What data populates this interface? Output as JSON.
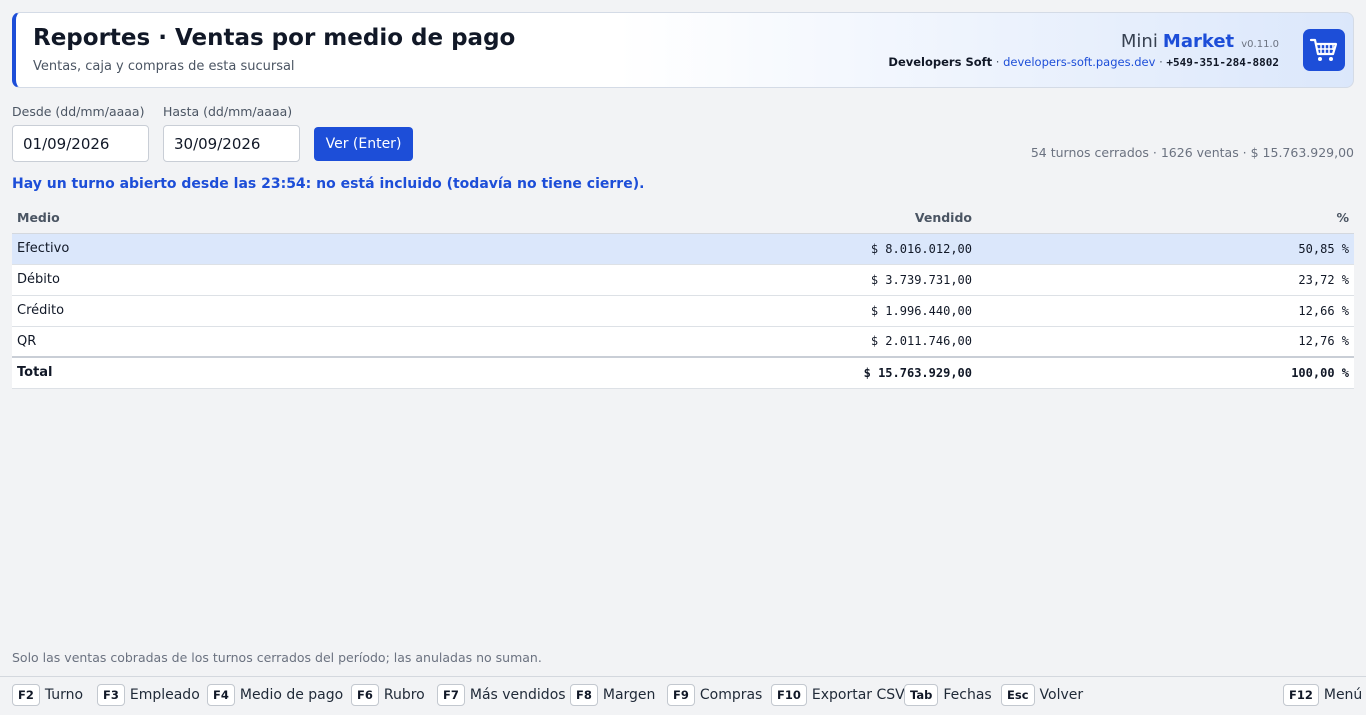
{
  "header": {
    "title": "Reportes · Ventas por medio de pago",
    "subtitle": "Ventas, caja y compras de esta sucursal",
    "brand_mini": "Mini",
    "brand_market": "Market",
    "version": "v0.11.0",
    "company": "Developers Soft",
    "sep1": " · ",
    "url": "developers-soft.pages.dev",
    "sep2": " · ",
    "phone": "+549-351-284-8802",
    "icon": "shopping-cart-icon"
  },
  "filters": {
    "desde_label": "Desde (dd/mm/aaaa)",
    "desde_value": "01/09/2026",
    "hasta_label": "Hasta (dd/mm/aaaa)",
    "hasta_value": "30/09/2026",
    "button_label": "Ver (Enter)"
  },
  "summary": "54 turnos cerrados · 1626 ventas · $ 15.763.929,00",
  "notice": "Hay un turno abierto desde las 23:54: no está incluido (todavía no tiene cierre).",
  "table": {
    "columns": [
      "Medio",
      "Vendido",
      "%"
    ],
    "rows": [
      {
        "medio": "Efectivo",
        "vendido": "$ 8.016.012,00",
        "pct": "50,85 %"
      },
      {
        "medio": "Débito",
        "vendido": "$ 3.739.731,00",
        "pct": "23,72 %"
      },
      {
        "medio": "Crédito",
        "vendido": "$ 1.996.440,00",
        "pct": "12,66 %"
      },
      {
        "medio": "QR",
        "vendido": "$ 2.011.746,00",
        "pct": "12,76 %"
      }
    ],
    "total": {
      "medio": "Total",
      "vendido": "$ 15.763.929,00",
      "pct": "100,00 %"
    }
  },
  "footnote": "Solo las ventas cobradas de los turnos cerrados del período; las anuladas no suman.",
  "footer": {
    "keys": [
      {
        "key": "F2",
        "label": "Turno"
      },
      {
        "key": "F3",
        "label": "Empleado"
      },
      {
        "key": "F4",
        "label": "Medio de pago"
      },
      {
        "key": "F6",
        "label": "Rubro"
      },
      {
        "key": "F7",
        "label": "Más vendidos"
      },
      {
        "key": "F8",
        "label": "Margen"
      },
      {
        "key": "F9",
        "label": "Compras"
      },
      {
        "key": "F10",
        "label": "Exportar CSV"
      },
      {
        "key": "Tab",
        "label": "Fechas"
      },
      {
        "key": "Esc",
        "label": "Volver"
      },
      {
        "key": "F12",
        "label": "Menú"
      }
    ]
  },
  "colors": {
    "accent": "#1d4ed8",
    "selected_row": "#dbe7fb"
  }
}
